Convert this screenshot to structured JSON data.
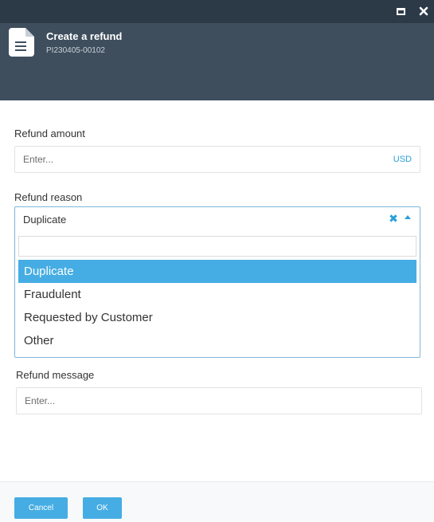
{
  "window": {
    "maximize_icon": "maximize-icon",
    "close_icon": "close-icon"
  },
  "header": {
    "icon": "document-icon",
    "title": "Create a refund",
    "subtitle": "PI230405-00102"
  },
  "form": {
    "amount": {
      "label": "Refund amount",
      "placeholder": "Enter...",
      "currency": "USD"
    },
    "reason": {
      "label": "Refund reason",
      "selected": "Duplicate",
      "options": [
        "Duplicate",
        "Fraudulent",
        "Requested by Customer",
        "Other"
      ],
      "highlighted_index": 0
    },
    "message": {
      "label": "Refund message",
      "placeholder": "Enter..."
    }
  },
  "footer": {
    "cancel_label": "Cancel",
    "ok_label": "OK"
  },
  "colors": {
    "accent": "#45ade3",
    "header": "#3e4e5d",
    "titlebar": "#2c3a47"
  }
}
